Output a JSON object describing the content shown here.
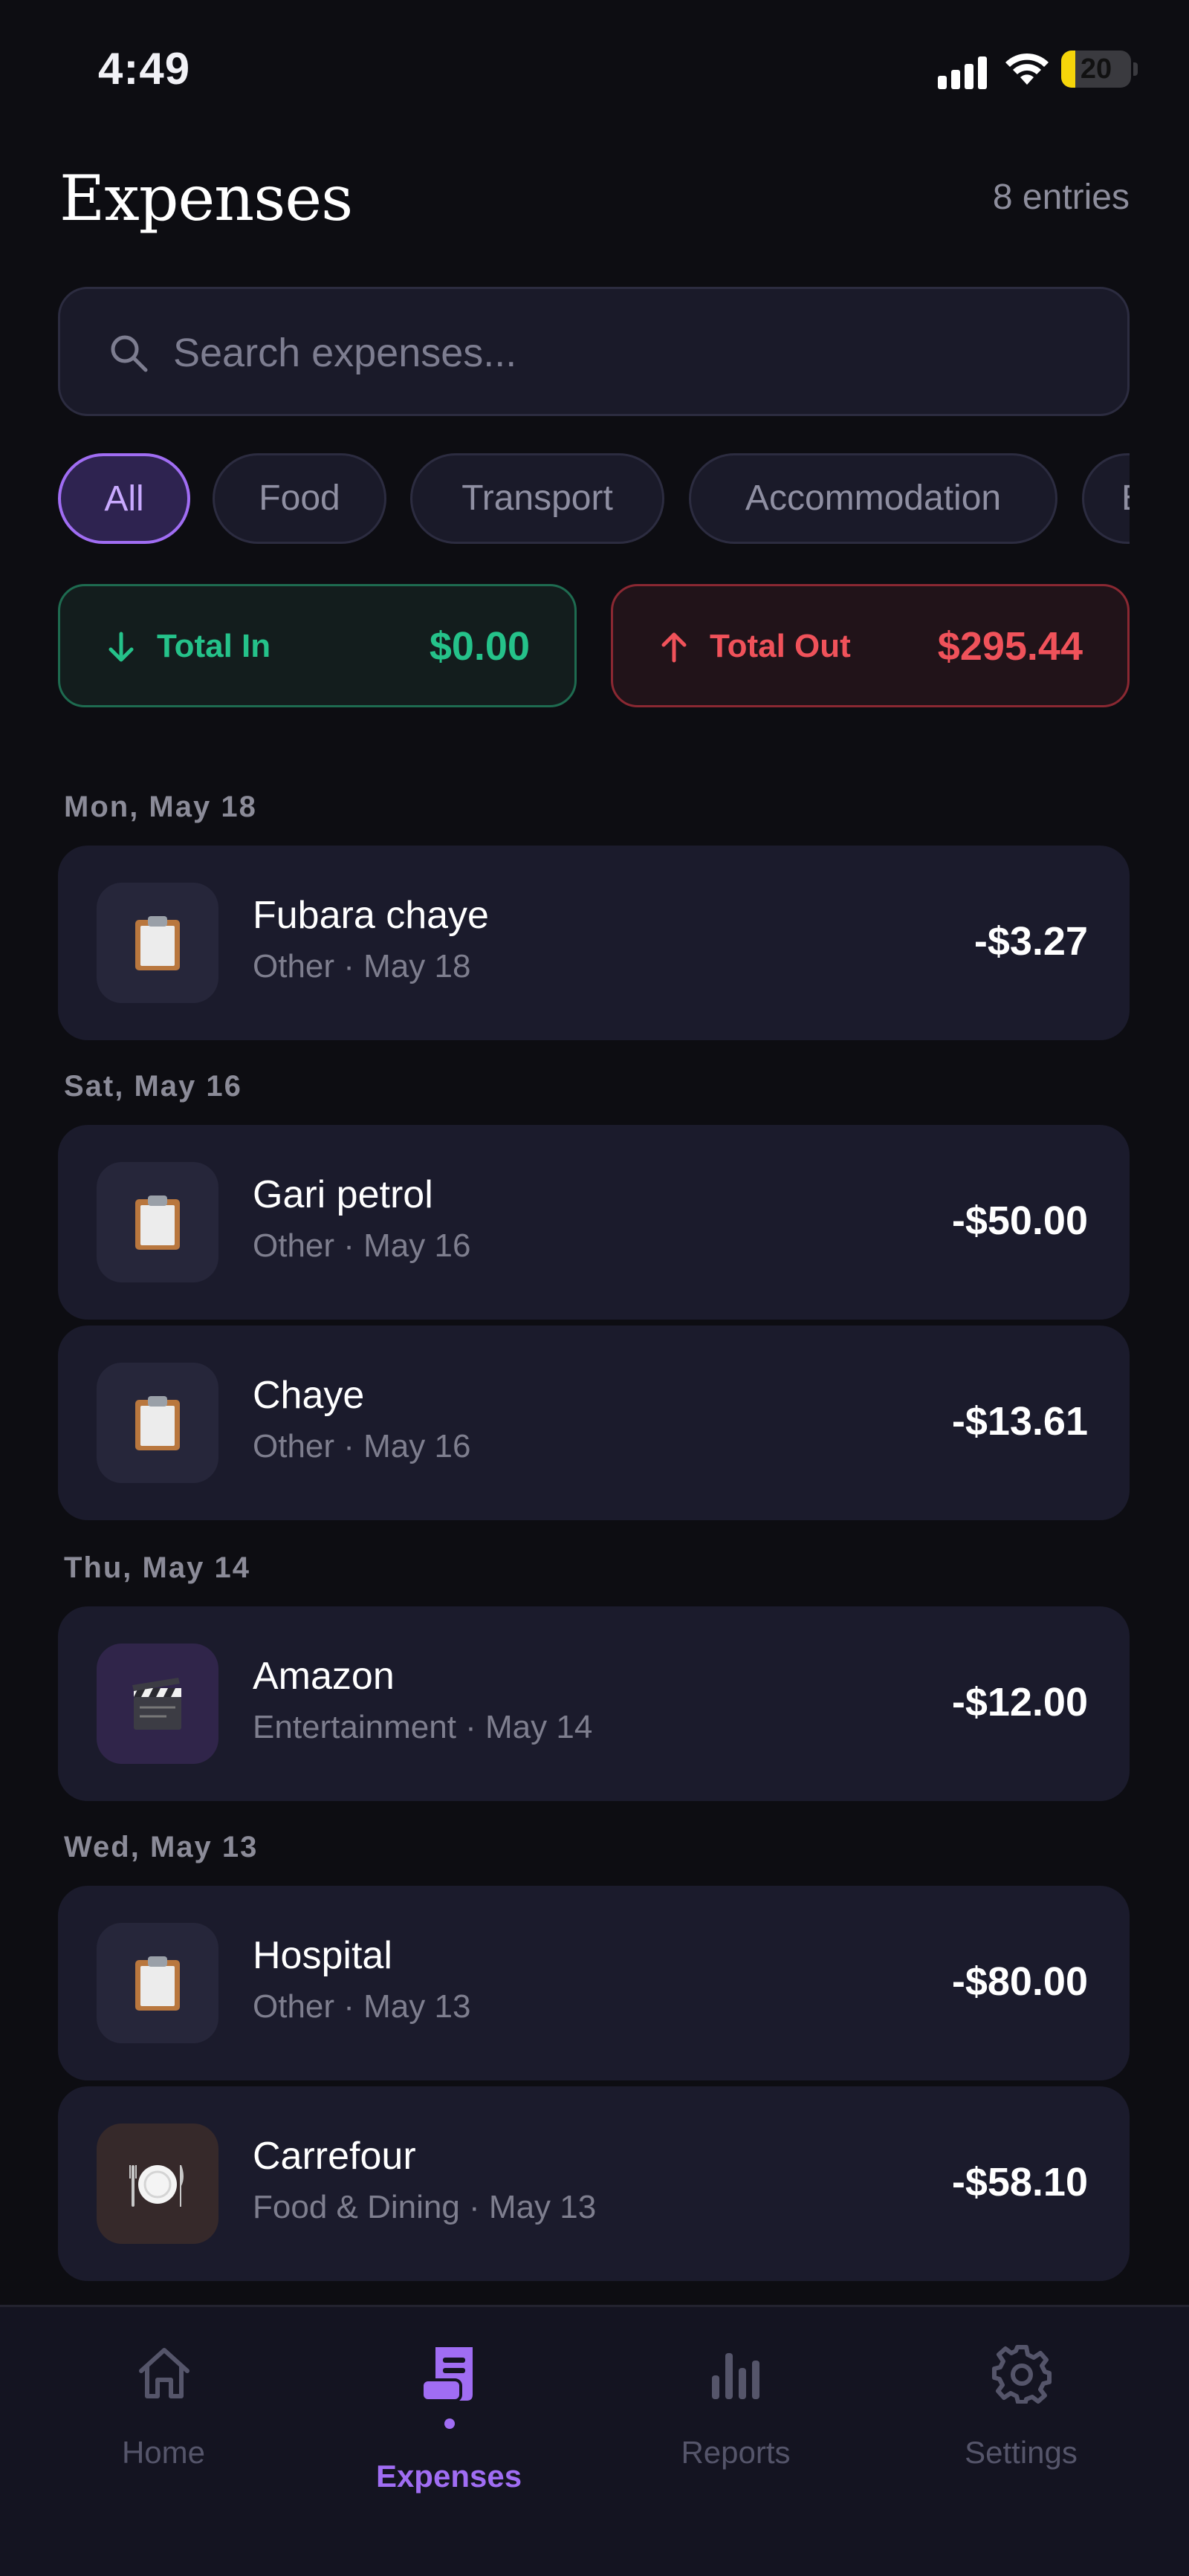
{
  "status_bar": {
    "time": "4:49",
    "battery": "20",
    "battery_level": 0.2
  },
  "header": {
    "title": "Expenses",
    "entries": "8 entries"
  },
  "search": {
    "placeholder": "Search expenses..."
  },
  "filters": [
    "All",
    "Food",
    "Transport",
    "Accommodation",
    "E"
  ],
  "active_filter": "All",
  "totals": {
    "in_label": "Total In",
    "in_value": "$0.00",
    "out_label": "Total Out",
    "out_value": "$295.44"
  },
  "groups": [
    {
      "day": "Mon, May 18",
      "items": [
        {
          "name": "Fubara chaye",
          "sub": "Other · May 18",
          "amount": "-$3.27",
          "icon": "clipboard-icon"
        }
      ]
    },
    {
      "day": "Sat, May 16",
      "items": [
        {
          "name": "Gari petrol",
          "sub": "Other · May 16",
          "amount": "-$50.00",
          "icon": "clipboard-icon"
        },
        {
          "name": "Chaye",
          "sub": "Other · May 16",
          "amount": "-$13.61",
          "icon": "clipboard-icon"
        }
      ]
    },
    {
      "day": "Thu, May 14",
      "items": [
        {
          "name": "Amazon",
          "sub": "Entertainment · May 14",
          "amount": "-$12.00",
          "icon": "clapperboard-icon"
        }
      ]
    },
    {
      "day": "Wed, May 13",
      "items": [
        {
          "name": "Hospital",
          "sub": "Other · May 13",
          "amount": "-$80.00",
          "icon": "clipboard-icon"
        },
        {
          "name": "Carrefour",
          "sub": "Food & Dining · May 13",
          "amount": "-$58.10",
          "icon": "plate-icon"
        }
      ]
    }
  ],
  "tabs": [
    {
      "label": "Home",
      "icon": "home-icon"
    },
    {
      "label": "Expenses",
      "icon": "receipt-icon"
    },
    {
      "label": "Reports",
      "icon": "bar-chart-icon"
    },
    {
      "label": "Settings",
      "icon": "gear-icon"
    }
  ],
  "active_tab": "Expenses",
  "colors": {
    "accent": "#a06df3",
    "income": "#25c28a",
    "expense": "#f0525a",
    "background": "#0d0d12",
    "card": "#1b1b2c"
  }
}
